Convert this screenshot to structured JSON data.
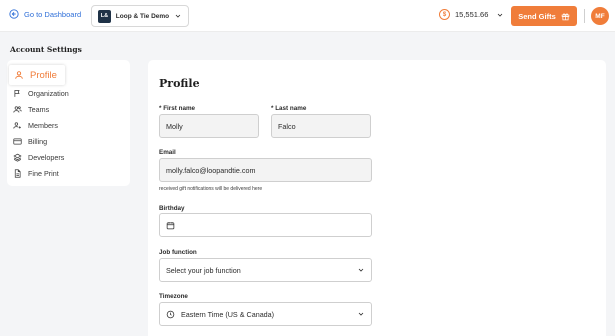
{
  "topbar": {
    "back_label": "Go to Dashboard",
    "org_badge": "L&",
    "org_name": "Loop & Tie Demo",
    "balance": "15,551.66",
    "coin_symbol": "$",
    "send_label": "Send Gifts",
    "avatar_initials": "MF"
  },
  "sidebar": {
    "heading": "Account Settings",
    "items": [
      {
        "label": "Profile",
        "icon": "user-icon"
      },
      {
        "label": "Organization",
        "icon": "flag-icon"
      },
      {
        "label": "Teams",
        "icon": "users-icon"
      },
      {
        "label": "Members",
        "icon": "user-plus-icon"
      },
      {
        "label": "Billing",
        "icon": "credit-card-icon"
      },
      {
        "label": "Developers",
        "icon": "layers-icon"
      },
      {
        "label": "Fine Print",
        "icon": "file-icon"
      }
    ]
  },
  "profile": {
    "title": "Profile",
    "first_name_label": "First name",
    "first_name_value": "Molly",
    "last_name_label": "Last name",
    "last_name_value": "Falco",
    "required_mark": "*",
    "email_label": "Email",
    "email_value": "molly.falco@loopandtie.com",
    "email_help": "received gift notifications will be delivered here",
    "birthday_label": "Birthday",
    "job_label": "Job function",
    "job_value": "Select your job function",
    "timezone_label": "Timezone",
    "timezone_value": "Eastern Time (US & Canada)"
  },
  "colors": {
    "accent": "#f07d3a",
    "link": "#2f6fd8",
    "org_badge": "#1f3247"
  }
}
